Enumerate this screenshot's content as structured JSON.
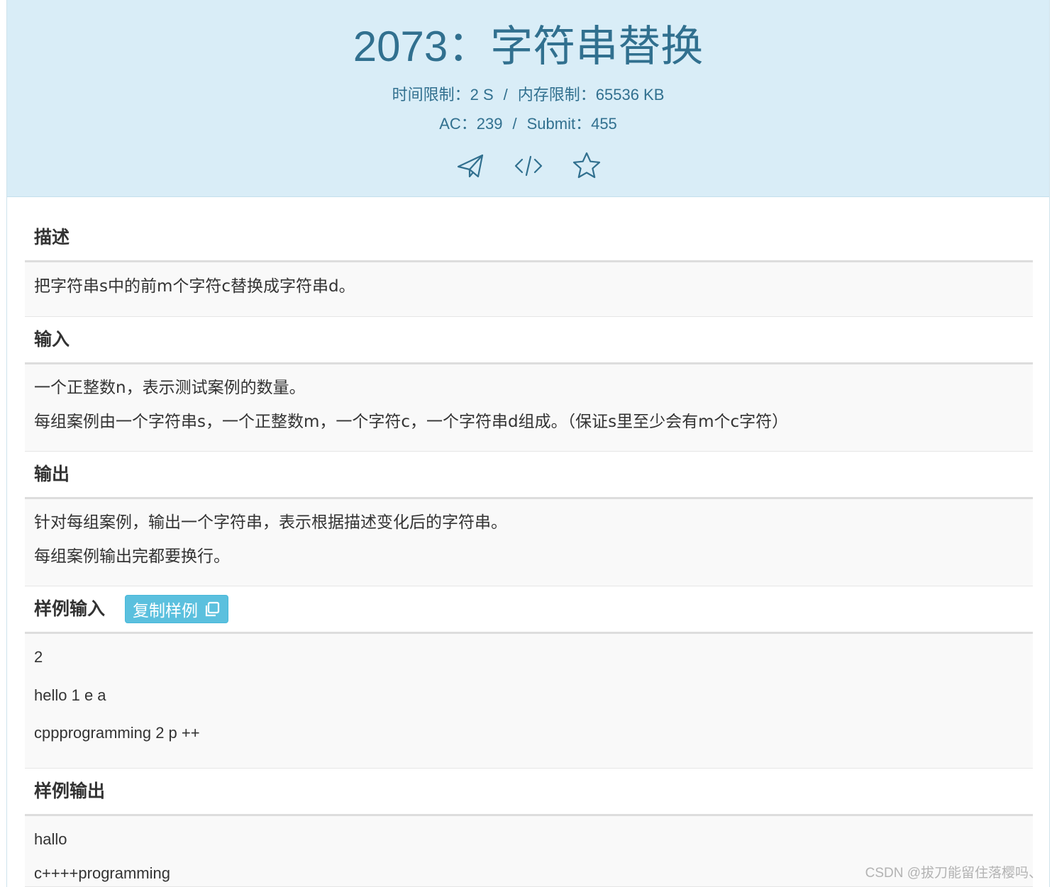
{
  "problem": {
    "title": "2073：字符串替换",
    "time_limit_label": "时间限制：",
    "time_limit": "2 S",
    "separator": "/",
    "memory_limit_label": "内存限制：",
    "memory_limit": "65536 KB",
    "ac_label": "AC：",
    "ac": "239",
    "submit_label": "Submit：",
    "submit": "455",
    "icons": [
      "paper-plane-icon",
      "code-icon",
      "star-icon"
    ]
  },
  "sections": {
    "description": {
      "heading": "描述",
      "lines": [
        "把字符串s中的前m个字符c替换成字符串d。"
      ]
    },
    "input": {
      "heading": "输入",
      "lines": [
        "一个正整数n，表示测试案例的数量。",
        "每组案例由一个字符串s，一个正整数m，一个字符c，一个字符串d组成。（保证s里至少会有m个c字符）"
      ]
    },
    "output": {
      "heading": "输出",
      "lines": [
        "针对每组案例，输出一个字符串，表示根据描述变化后的字符串。",
        "每组案例输出完都要换行。"
      ]
    },
    "sample_input": {
      "heading": "样例输入",
      "copy_button": "复制样例",
      "lines": [
        "2",
        "hello 1 e a",
        "cppprogramming 2 p ++"
      ]
    },
    "sample_output": {
      "heading": "样例输出",
      "lines": [
        "hallo",
        "c++++programming"
      ]
    }
  },
  "watermark": "CSDN @拔刀能留住落樱吗、",
  "colors": {
    "header_bg": "#d9edf7",
    "header_text": "#31708f",
    "body_bg": "#f9f9f9",
    "copy_button_bg": "#5bc0de"
  }
}
